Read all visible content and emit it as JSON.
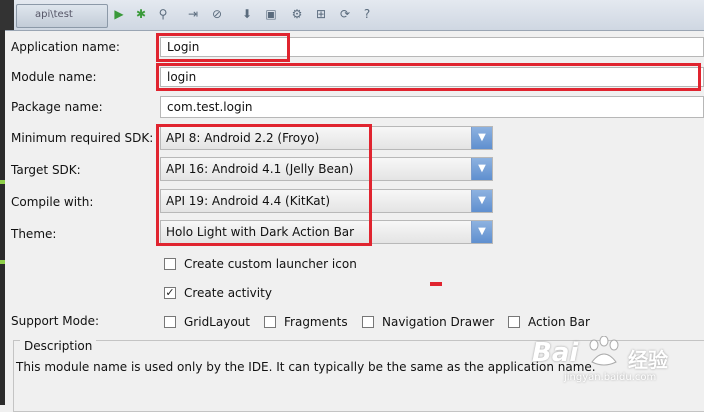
{
  "toolbar": {
    "tab_label": "api\\test"
  },
  "form": {
    "application_name": {
      "label": "Application name:",
      "value": "Login"
    },
    "module_name": {
      "label": "Module name:",
      "value": "login"
    },
    "package_name": {
      "label": "Package name:",
      "value": "com.test.login"
    },
    "min_sdk": {
      "label": "Minimum required SDK:",
      "value": "API 8: Android 2.2 (Froyo)"
    },
    "target_sdk": {
      "label": "Target SDK:",
      "value": "API 16: Android 4.1 (Jelly Bean)"
    },
    "compile_with": {
      "label": "Compile with:",
      "value": "API 19: Android 4.4 (KitKat)"
    },
    "theme": {
      "label": "Theme:",
      "value": "Holo Light with Dark Action Bar"
    }
  },
  "options": {
    "create_launcher_icon": {
      "label": "Create custom launcher icon",
      "checked": false
    },
    "create_activity": {
      "label": "Create activity",
      "checked": true
    }
  },
  "support_mode": {
    "label": "Support Mode:",
    "items": [
      {
        "label": "GridLayout",
        "checked": false
      },
      {
        "label": "Fragments",
        "checked": false
      },
      {
        "label": "Navigation Drawer",
        "checked": false
      },
      {
        "label": "Action Bar",
        "checked": false
      }
    ]
  },
  "description": {
    "title": "Description",
    "text": "This module name is used only by the IDE. It can typically be the same as the application name."
  },
  "watermark": {
    "logo": "Bai",
    "cn": "经验",
    "url": "jingyan.baidu.com"
  },
  "colors": {
    "highlight": "#e0242f",
    "combo_arrow": "#5f8fcf"
  }
}
